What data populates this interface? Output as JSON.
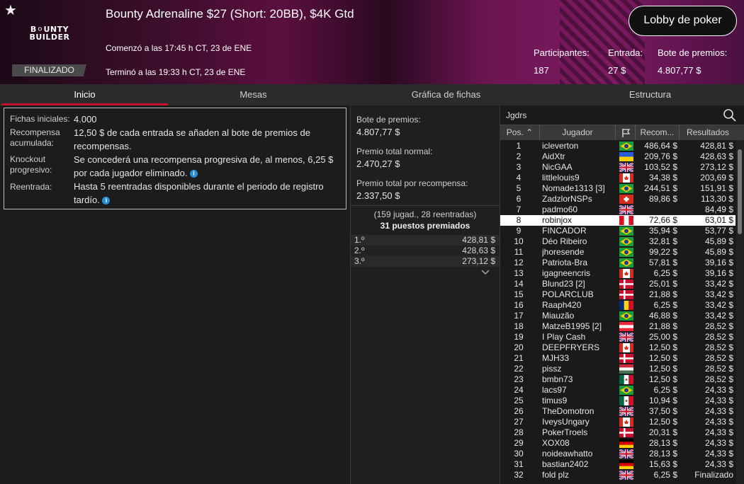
{
  "header": {
    "title": "Bounty Adrenaline $27 (Short: 20BB), $4K Gtd",
    "started": "Comenzó a las 17:45 h CT, 23 de ENE",
    "ended": "Terminó a las 19:33 h CT, 23 de ENE",
    "status": "FINALIZADO",
    "logo_line1": "B⚪UNTY",
    "logo_line2": "BUILDER",
    "lobby_button": "Lobby de poker",
    "participants_label": "Participantes:",
    "participants": "187",
    "entry_label": "Entrada:",
    "entry": "27 $",
    "prize_label": "Bote de premios:",
    "prize": "4.807,77 $",
    "star_icon": "★"
  },
  "tabs": [
    "Inicio",
    "Mesas",
    "Gráfica de fichas",
    "Estructura"
  ],
  "info": {
    "row1_label": "Fichas iniciales:",
    "row1_value": "4.000",
    "row2_label_a": "Recompensa",
    "row2_label_b": "acumulada:",
    "row2_value": "12,50 $ de cada entrada se añaden al bote de premios de recompensas.",
    "row3_label_a": "Knockout",
    "row3_label_b": "progresivo:",
    "row3_value": "Se concederá una recompensa progresiva de, al menos, 6,25 $ por cada jugador eliminado.",
    "row4_label": "Reentrada:",
    "row4_value": "Hasta 5 reentradas disponibles durante el periodo de registro tardío."
  },
  "pool": {
    "l1": "Bote de premios:",
    "v1": "4.807,77 $",
    "l2": "Premio total normal:",
    "v2": "2.470,27 $",
    "l3": "Premio total por recompensa:",
    "v3": "2.337,50 $",
    "summary": "(159 jugad., 28 reentradas)",
    "paid": "31 puestos premiados",
    "payouts": [
      {
        "place": "1.º",
        "amount": "428,81 $"
      },
      {
        "place": "2.º",
        "amount": "428,63 $"
      },
      {
        "place": "3.º",
        "amount": "273,12 $"
      }
    ]
  },
  "players": {
    "search": "Jgdrs",
    "col_pos": "Pos.",
    "col_player": "Jugador",
    "col_bounty": "Recom...",
    "col_result": "Resultados",
    "rows": [
      [
        "1",
        "icleverton",
        "br",
        "486,64 $",
        "428,81 $"
      ],
      [
        "2",
        "AidXtr",
        "ua",
        "209,76 $",
        "428,63 $"
      ],
      [
        "3",
        "NicGAA",
        "gb",
        "103,52 $",
        "273,12 $"
      ],
      [
        "4",
        "littlelouis9",
        "ca",
        "34,38 $",
        "203,69 $"
      ],
      [
        "5",
        "Nomade1313 [3]",
        "br",
        "244,51 $",
        "151,91 $"
      ],
      [
        "6",
        "ZadzlorNSPs",
        "ch",
        "89,86 $",
        "113,30 $"
      ],
      [
        "7",
        "padmo60",
        "gb",
        "",
        "84,49 $"
      ],
      [
        "8",
        "robinjox",
        "pe",
        "72,66 $",
        "63,01 $"
      ],
      [
        "9",
        "FINCADOR",
        "br",
        "35,94 $",
        "53,77 $"
      ],
      [
        "10",
        "Déo Ribeiro",
        "br",
        "32,81 $",
        "45,89 $"
      ],
      [
        "11",
        "jhoresende",
        "br",
        "99,22 $",
        "45,89 $"
      ],
      [
        "12",
        "Patriota-Bra",
        "br",
        "57,81 $",
        "39,16 $"
      ],
      [
        "13",
        "igagneencris",
        "ca",
        "6,25 $",
        "39,16 $"
      ],
      [
        "14",
        "Blund23 [2]",
        "dk",
        "25,01 $",
        "33,42 $"
      ],
      [
        "15",
        "POLARCLUB",
        "dk",
        "21,88 $",
        "33,42 $"
      ],
      [
        "16",
        "Raaph420",
        "ro",
        "6,25 $",
        "33,42 $"
      ],
      [
        "17",
        "Miauzão",
        "br",
        "46,88 $",
        "33,42 $"
      ],
      [
        "18",
        "MatzeB1995 [2]",
        "at",
        "21,88 $",
        "28,52 $"
      ],
      [
        "19",
        "I Play Cash",
        "gb",
        "25,00 $",
        "28,52 $"
      ],
      [
        "20",
        "DEEPFRYERS",
        "ca",
        "12,50 $",
        "28,52 $"
      ],
      [
        "21",
        "MJH33",
        "dk",
        "12,50 $",
        "28,52 $"
      ],
      [
        "22",
        "pissz",
        "hu",
        "12,50 $",
        "28,52 $"
      ],
      [
        "23",
        "bmbn73",
        "mx",
        "12,50 $",
        "28,52 $"
      ],
      [
        "24",
        "lacs97",
        "br",
        "6,25 $",
        "24,33 $"
      ],
      [
        "25",
        "timus9",
        "mx",
        "10,94 $",
        "24,33 $"
      ],
      [
        "26",
        "TheDomotron",
        "gb",
        "37,50 $",
        "24,33 $"
      ],
      [
        "27",
        "IveysUngary",
        "ca",
        "12,50 $",
        "24,33 $"
      ],
      [
        "28",
        "PokerTroels",
        "dk",
        "20,31 $",
        "24,33 $"
      ],
      [
        "29",
        "XOX08",
        "de",
        "28,13 $",
        "24,33 $"
      ],
      [
        "30",
        "noideawhatto",
        "gb",
        "28,13 $",
        "24,33 $"
      ],
      [
        "31",
        "bastian2402",
        "de",
        "15,63 $",
        "24,33 $"
      ],
      [
        "32",
        "fold plz",
        "gb",
        "6,25 $",
        "Finalizado"
      ]
    ]
  }
}
